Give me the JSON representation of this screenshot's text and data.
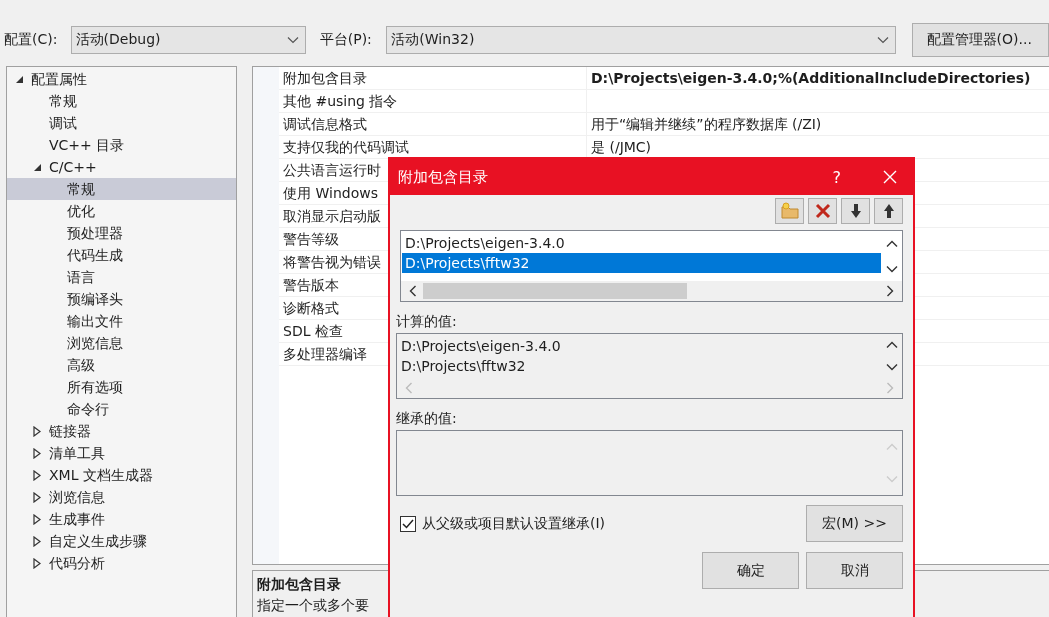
{
  "config_bar": {
    "configuration_label": "配置(C):",
    "configuration_value": "活动(Debug)",
    "platform_label": "平台(P):",
    "platform_value": "活动(Win32)",
    "manager_button": "配置管理器(O)..."
  },
  "tree": [
    {
      "label": "配置属性",
      "expanded": true,
      "selected": false,
      "children": [
        {
          "label": "常规",
          "selected": false
        },
        {
          "label": "调试",
          "selected": false
        },
        {
          "label": "VC++ 目录",
          "selected": false
        },
        {
          "label": "C/C++",
          "expanded": true,
          "selected": false,
          "children": [
            {
              "label": "常规",
              "selected": true
            },
            {
              "label": "优化",
              "selected": false
            },
            {
              "label": "预处理器",
              "selected": false
            },
            {
              "label": "代码生成",
              "selected": false
            },
            {
              "label": "语言",
              "selected": false
            },
            {
              "label": "预编译头",
              "selected": false
            },
            {
              "label": "输出文件",
              "selected": false
            },
            {
              "label": "浏览信息",
              "selected": false
            },
            {
              "label": "高级",
              "selected": false
            },
            {
              "label": "所有选项",
              "selected": false
            },
            {
              "label": "命令行",
              "selected": false
            }
          ]
        },
        {
          "label": "链接器",
          "expanded": false,
          "selected": false
        },
        {
          "label": "清单工具",
          "expanded": false,
          "selected": false
        },
        {
          "label": "XML 文档生成器",
          "expanded": false,
          "selected": false
        },
        {
          "label": "浏览信息",
          "expanded": false,
          "selected": false
        },
        {
          "label": "生成事件",
          "expanded": false,
          "selected": false
        },
        {
          "label": "自定义生成步骤",
          "expanded": false,
          "selected": false
        },
        {
          "label": "代码分析",
          "expanded": false,
          "selected": false
        }
      ]
    }
  ],
  "properties": [
    {
      "name": "附加包含目录",
      "value": "D:\\Projects\\eigen-3.4.0;%(AdditionalIncludeDirectories)",
      "modified": true
    },
    {
      "name": "其他 #using 指令"
    },
    {
      "name": "调试信息格式",
      "value": "用于“编辑并继续”的程序数据库 (/ZI)",
      "modified": false
    },
    {
      "name": "支持仅我的代码调试",
      "value": "是 (/JMC)",
      "modified": false
    },
    {
      "name": "公共语言运行时"
    },
    {
      "name": "使用 Windows"
    },
    {
      "name": "取消显示启动版"
    },
    {
      "name": "警告等级"
    },
    {
      "name": "将警告视为错误"
    },
    {
      "name": "警告版本"
    },
    {
      "name": "诊断格式"
    },
    {
      "name": "SDL 检查"
    },
    {
      "name": "多处理器编译"
    }
  ],
  "description": {
    "title": "附加包含目录",
    "text": "指定一个或多个要"
  },
  "dialog": {
    "title": "附加包含目录",
    "help": "?",
    "directories": [
      {
        "path": "D:\\Projects\\eigen-3.4.0",
        "selected": false
      },
      {
        "path": "D:\\Projects\\fftw32",
        "selected": true
      }
    ],
    "computed_label": "计算的值:",
    "computed_values": [
      "D:\\Projects\\eigen-3.4.0",
      "D:\\Projects\\fftw32"
    ],
    "inherited_label": "继承的值:",
    "inherit": {
      "label": "从父级或项目默认设置继承(I)",
      "checked": true
    },
    "macros_button": "宏(M) >>",
    "ok_button": "确定",
    "cancel_button": "取消"
  }
}
